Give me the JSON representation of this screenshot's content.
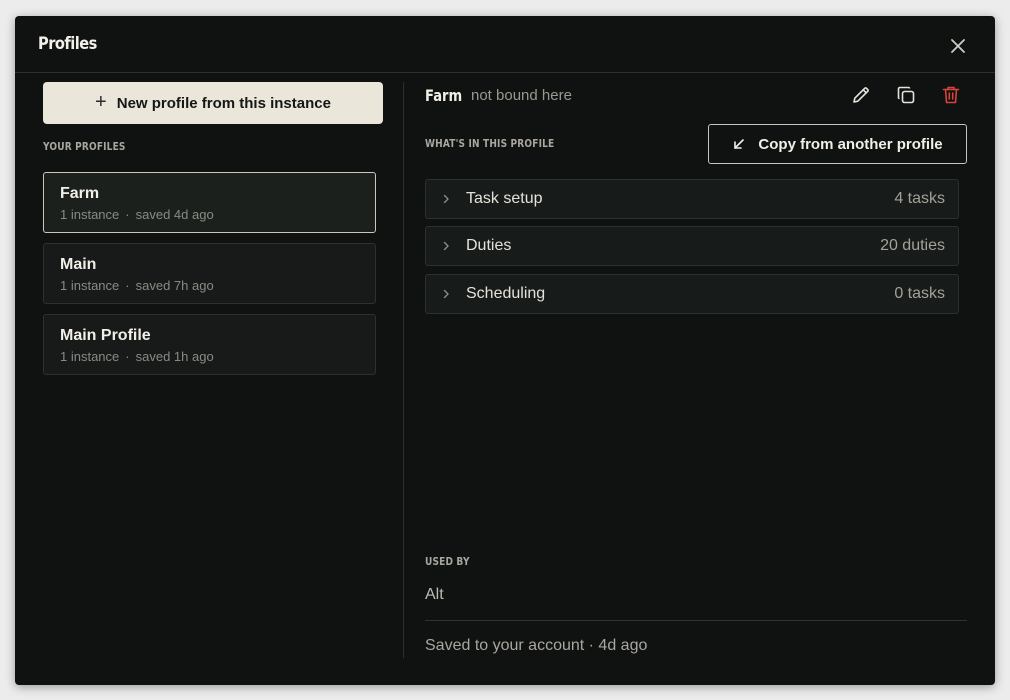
{
  "dialog": {
    "title": "Profiles",
    "close_icon": "close-icon"
  },
  "left": {
    "new_profile_label": "New profile from this instance",
    "section_label": "YOUR PROFILES",
    "profiles": [
      {
        "name": "Farm",
        "instances": "1 instance",
        "separator": "·",
        "saved": "saved 4d ago",
        "selected": true
      },
      {
        "name": "Main",
        "instances": "1 instance",
        "separator": "·",
        "saved": "saved 7h ago",
        "selected": false
      },
      {
        "name": "Main Profile",
        "instances": "1 instance",
        "separator": "·",
        "saved": "saved 1h ago",
        "selected": false
      }
    ]
  },
  "detail": {
    "name": "Farm",
    "status": "not bound here",
    "actions": [
      "edit-icon",
      "duplicate-icon",
      "delete-icon"
    ],
    "contents_label": "WHAT'S IN THIS PROFILE",
    "copy_from_label": "Copy from another profile",
    "sections": [
      {
        "label": "Task setup",
        "count": "4 tasks"
      },
      {
        "label": "Duties",
        "count": "20 duties"
      },
      {
        "label": "Scheduling",
        "count": "0 tasks"
      }
    ],
    "used_by_label": "USED BY",
    "used_by_value": "Alt",
    "footer": "Saved to your account · 4d ago"
  },
  "colors": {
    "background": "#0f1211",
    "primary_button": "#eae6da",
    "danger": "#d9443a",
    "selected_border": "#c9c6bb"
  }
}
